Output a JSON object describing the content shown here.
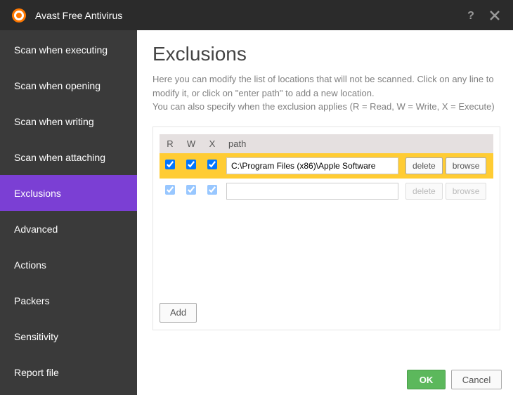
{
  "app": {
    "title": "Avast Free Antivirus"
  },
  "sidebar": {
    "items": [
      {
        "label": "Scan when executing",
        "active": false
      },
      {
        "label": "Scan when opening",
        "active": false
      },
      {
        "label": "Scan when writing",
        "active": false
      },
      {
        "label": "Scan when attaching",
        "active": false
      },
      {
        "label": "Exclusions",
        "active": true
      },
      {
        "label": "Advanced",
        "active": false
      },
      {
        "label": "Actions",
        "active": false
      },
      {
        "label": "Packers",
        "active": false
      },
      {
        "label": "Sensitivity",
        "active": false
      },
      {
        "label": "Report file",
        "active": false
      }
    ]
  },
  "main": {
    "title": "Exclusions",
    "description1": "Here you can modify the list of locations that will not be scanned. Click on any line to modify it, or click on \"enter path\" to add a new location.",
    "description2": "You can also specify when the exclusion applies (R = Read, W = Write, X = Execute)",
    "table": {
      "headers": {
        "r": "R",
        "w": "W",
        "x": "X",
        "path": "path"
      },
      "rows": [
        {
          "r": true,
          "w": true,
          "x": true,
          "path": "C:\\Program Files (x86)\\Apple Software",
          "active": true
        },
        {
          "r": true,
          "w": true,
          "x": true,
          "path": "",
          "active": false
        }
      ]
    },
    "buttons": {
      "delete": "delete",
      "browse": "browse",
      "add": "Add",
      "ok": "OK",
      "cancel": "Cancel"
    }
  }
}
